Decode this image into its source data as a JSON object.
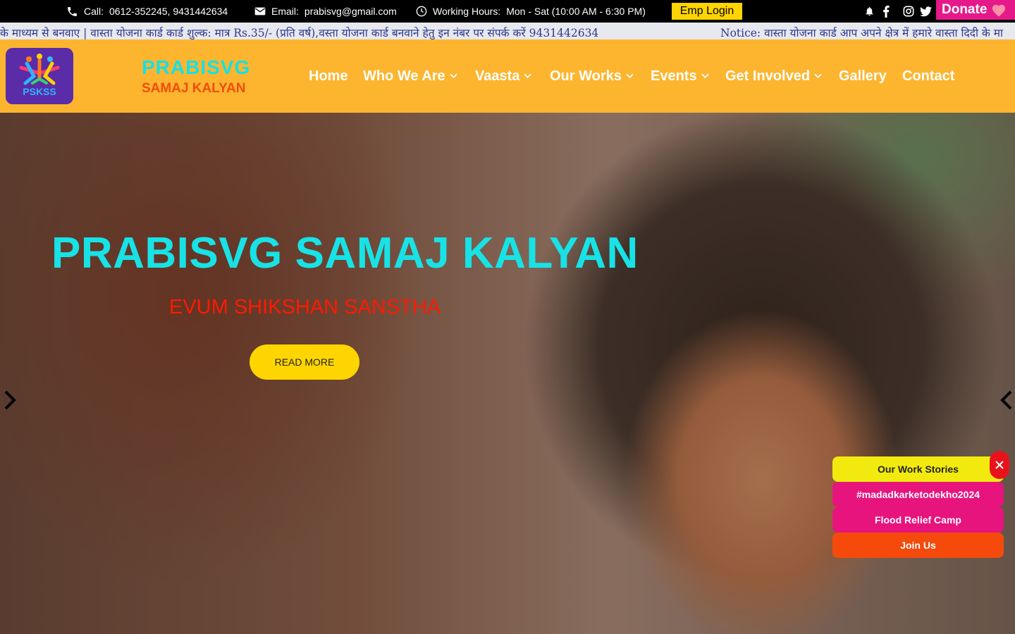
{
  "topbar": {
    "call_label": "Call:",
    "call_value": "0612-352245, 9431442634",
    "email_label": "Email:",
    "email_value": "prabisvg@gmail.com",
    "hours_label": "Working Hours:",
    "hours_value": "Mon - Sat (10:00 AM - 6:30 PM)",
    "emp_login": "Emp Login",
    "donate": "Donate"
  },
  "ticker": {
    "text1": "के माध्यम से बनवाए | वास्ता योजना कार्ड कार्ड शुल्क: मात्र Rs.35/- (प्रति वर्ष),वस्ता योजना कार्ड बनवाने हेतु इन नंबर पर संपर्क करें 9431442634",
    "text2": "Notice: वास्ता योजना कार्ड आप अपने क्षेत्र में हमारे वास्ता दिदी के मा"
  },
  "header": {
    "logo_text": "PSKSS",
    "brand_line1": "PRABISVG",
    "brand_line2": "SAMAJ KALYAN",
    "nav": [
      "Home",
      "Who We Are",
      "Vaasta",
      "Our Works",
      "Events",
      "Get Involved",
      "Gallery",
      "Contact"
    ]
  },
  "hero": {
    "title_part1": "PRABISVG",
    "title_part2": "SAMAJ KALYAN",
    "subtitle": "EVUM SHIKSHAN SANSTHA",
    "button": "READ MORE"
  },
  "floating": {
    "items": [
      "Our Work Stories",
      "#madadkarketodekho2024",
      "Flood Relief Camp",
      "Join Us"
    ]
  },
  "colors": {
    "header_bg": "#fdb52f",
    "brand_cyan": "#16e0e6",
    "brand_orange": "#f14d0a",
    "donate_pink": "#e6198a",
    "button_yellow": "#ffd500"
  }
}
